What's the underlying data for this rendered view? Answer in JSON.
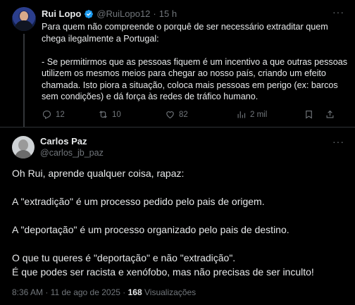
{
  "tweet1": {
    "name": "Rui Lopo",
    "handle": "@RuiLopo12",
    "time": "15 h",
    "separator": "·",
    "text": "Para quem não compreende o porquê de ser necessário extraditar quem chega ilegalmente a Portugal:\n\n- Se permitirmos que as pessoas fiquem é um incentivo a que outras pessoas utilizem os mesmos meios para chegar ao nosso país, criando um efeito chamada. Isto piora a situação, coloca mais pessoas em perigo (ex: barcos sem condições) e dá força às redes de tráfico humano.",
    "replies": "12",
    "reposts": "10",
    "likes": "82",
    "views": "2 mil",
    "icons": [
      "verified-badge-icon",
      "reply-icon",
      "repost-icon",
      "like-icon",
      "views-icon",
      "bookmark-icon",
      "share-icon",
      "more-icon"
    ],
    "accent": "#1d9bf0"
  },
  "tweet2": {
    "name": "Carlos Paz",
    "handle": "@carlos_jb_paz",
    "text": "Oh Rui, aprende qualquer coisa, rapaz:\n\nA \"extradição\" é um processo pedido pelo pais de origem.\n\nA \"deportação\" é um processo organizado pelo pais de destino.\n\nO que tu queres é \"deportação\" e não \"extradição\".\nÉ que podes ser racista e xenófobo, mas não precisas de ser inculto!",
    "time": "8:36 AM",
    "date": "11 de ago de 2025",
    "separator": "·",
    "views_count": "168",
    "views_label": "Visualizações"
  }
}
